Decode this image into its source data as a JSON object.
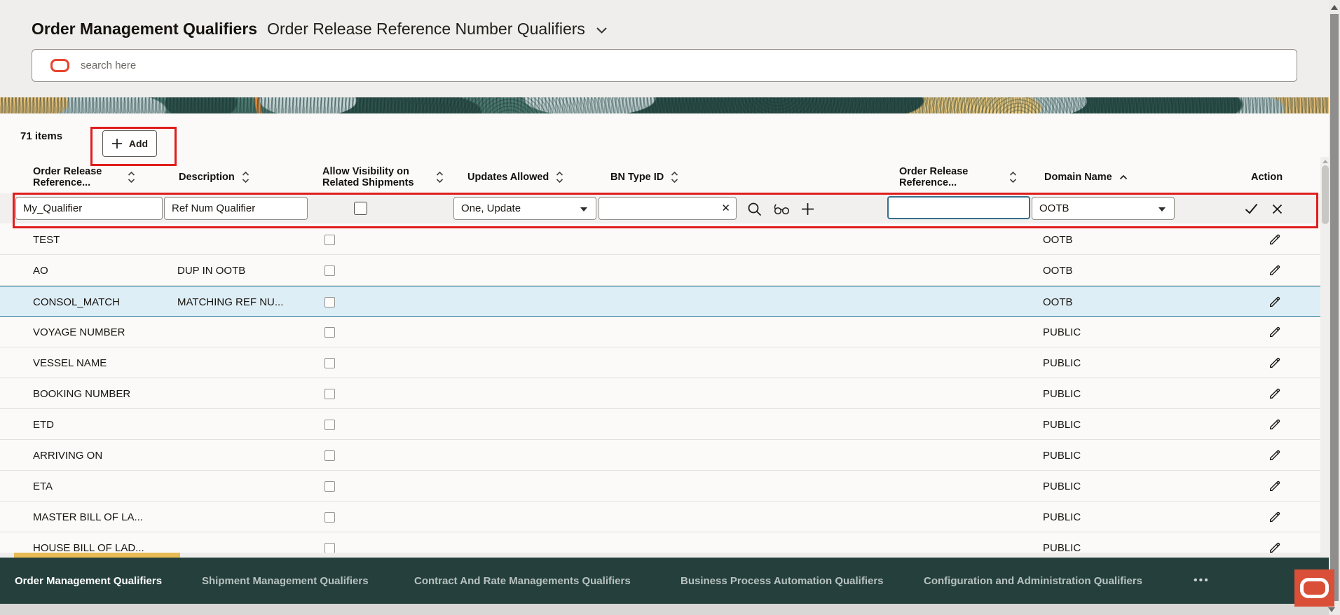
{
  "app": {
    "title": "Order Management Qualifiers",
    "subtitle": "Order Release Reference Number Qualifiers"
  },
  "search": {
    "placeholder": "search here"
  },
  "toolbar": {
    "items_count": "71 items",
    "add_label": "Add"
  },
  "table": {
    "headers": {
      "qualifier": "Order Release Reference...",
      "description": "Description",
      "allow_visibility": "Allow Visibility on Related Shipments",
      "updates_allowed": "Updates Allowed",
      "bn_type": "BN Type ID",
      "order_release_reference": "Order Release Reference...",
      "domain_name": "Domain Name",
      "action": "Action"
    },
    "edit_row": {
      "qualifier": "My_Qualifier",
      "description": "Ref Num Qualifier",
      "allow_visibility_checked": false,
      "updates_allowed": "One, Update",
      "bn_type": "",
      "order_release_reference": "",
      "domain_name": "OOTB"
    },
    "rows": [
      {
        "qualifier": "TEST",
        "description": "",
        "domain": "OOTB",
        "selected": false
      },
      {
        "qualifier": "AO",
        "description": "DUP IN OOTB",
        "domain": "OOTB",
        "selected": false
      },
      {
        "qualifier": "CONSOL_MATCH",
        "description": "MATCHING REF NU...",
        "domain": "OOTB",
        "selected": true
      },
      {
        "qualifier": "VOYAGE NUMBER",
        "description": "",
        "domain": "PUBLIC",
        "selected": false
      },
      {
        "qualifier": "VESSEL NAME",
        "description": "",
        "domain": "PUBLIC",
        "selected": false
      },
      {
        "qualifier": "BOOKING NUMBER",
        "description": "",
        "domain": "PUBLIC",
        "selected": false
      },
      {
        "qualifier": "ETD",
        "description": "",
        "domain": "PUBLIC",
        "selected": false
      },
      {
        "qualifier": "ARRIVING ON",
        "description": "",
        "domain": "PUBLIC",
        "selected": false
      },
      {
        "qualifier": "ETA",
        "description": "",
        "domain": "PUBLIC",
        "selected": false
      },
      {
        "qualifier": "MASTER BILL OF LA...",
        "description": "",
        "domain": "PUBLIC",
        "selected": false
      },
      {
        "qualifier": "HOUSE BILL OF LAD...",
        "description": "",
        "domain": "PUBLIC",
        "selected": false
      }
    ]
  },
  "bottom_nav": {
    "tabs": [
      {
        "label": "Order Management Qualifiers",
        "active": true
      },
      {
        "label": "Shipment Management Qualifiers",
        "active": false
      },
      {
        "label": "Contract And Rate Managements Qualifiers",
        "active": false
      },
      {
        "label": "Business Process Automation Qualifiers",
        "active": false
      },
      {
        "label": "Configuration and Administration Qualifiers",
        "active": false
      }
    ],
    "overflow_label": "•••"
  },
  "colors": {
    "annotation_red": "#e01e1e",
    "banner_teal": "#4e7a72",
    "nav_background": "#25403c",
    "active_tab_gold": "#e8bb54",
    "selected_row_blue": "#deeef6",
    "oracle_red": "#d94f38",
    "focus_border": "#356f8f"
  }
}
